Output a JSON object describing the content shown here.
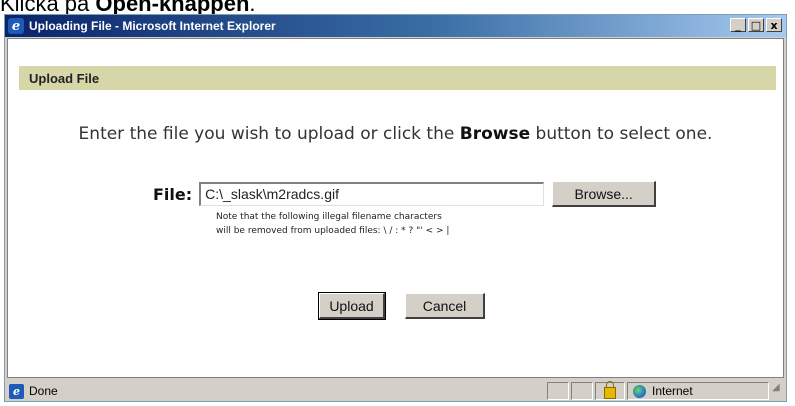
{
  "caption": {
    "prefix": "Klicka på ",
    "bold": "Open-knappen",
    "suffix": "."
  },
  "window": {
    "title": "Uploading File - Microsoft Internet Explorer",
    "controls": {
      "minimize": "_",
      "maximize": "□",
      "close": "x"
    }
  },
  "section_header": "Upload File",
  "instruction": {
    "before": "Enter the file you wish to upload or click the ",
    "bold": "Browse",
    "after": " button to select one."
  },
  "file_field": {
    "label": "File:",
    "value": "C:\\_slask\\m2radcs.gif"
  },
  "browse_button": "Browse...",
  "note": {
    "line1": "Note that the following illegal filename characters",
    "line2": "will be removed from uploaded files: \\ / : * ? \"' < > |"
  },
  "buttons": {
    "upload": "Upload",
    "cancel": "Cancel"
  },
  "status": {
    "text": "Done",
    "zone": "Internet"
  },
  "icons": [
    "ie-icon",
    "lock-icon",
    "globe-icon",
    "resize-grip-icon"
  ]
}
